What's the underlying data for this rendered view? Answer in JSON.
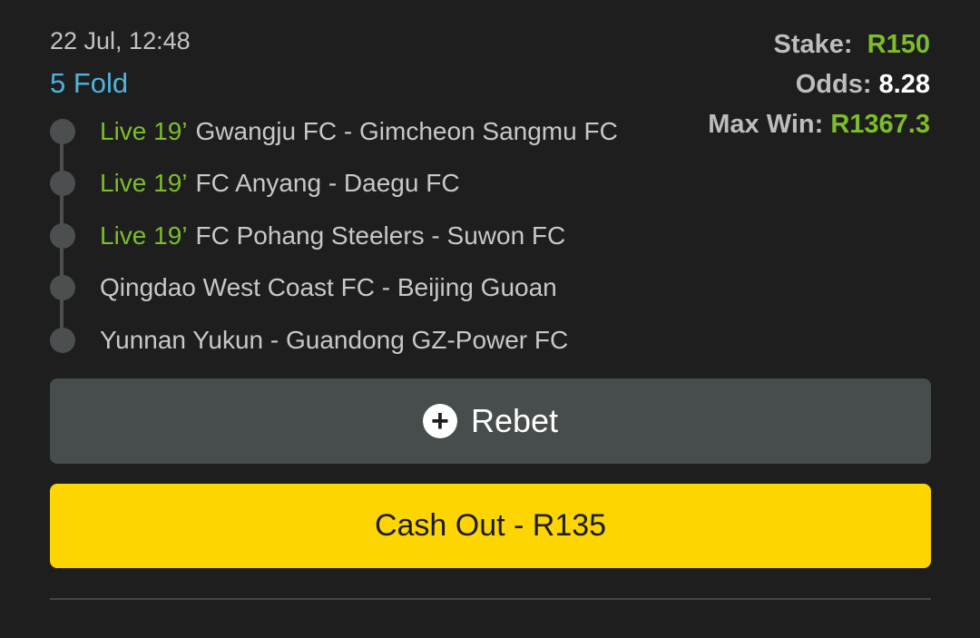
{
  "bet": {
    "date": "22 Jul, 12:48",
    "type": "5 Fold"
  },
  "summary": {
    "stake_label": "Stake:",
    "stake_value": "R150",
    "odds_label": "Odds:",
    "odds_value": "8.28",
    "maxwin_label": "Max Win:",
    "maxwin_value": "R1367.3"
  },
  "legs": [
    {
      "status": "Live 19’",
      "match": "Gwangju FC - Gimcheon Sangmu FC"
    },
    {
      "status": "Live 19’",
      "match": "FC Anyang - Daegu FC"
    },
    {
      "status": "Live 19’",
      "match": "FC Pohang Steelers - Suwon FC"
    },
    {
      "status": "",
      "match": "Qingdao West Coast FC - Beijing Guoan"
    },
    {
      "status": "",
      "match": "Yunnan Yukun - Guandong GZ-Power FC"
    }
  ],
  "actions": {
    "rebet_icon": "plus-circle-icon",
    "rebet_label": "Rebet",
    "cashout_label": "Cash Out - R135"
  },
  "colors": {
    "live": "#7cbd2a",
    "fold": "#4fb3dc",
    "cashout_bg": "#fdd500",
    "rebet_bg": "#474c4d",
    "background": "#1e1e1e"
  }
}
